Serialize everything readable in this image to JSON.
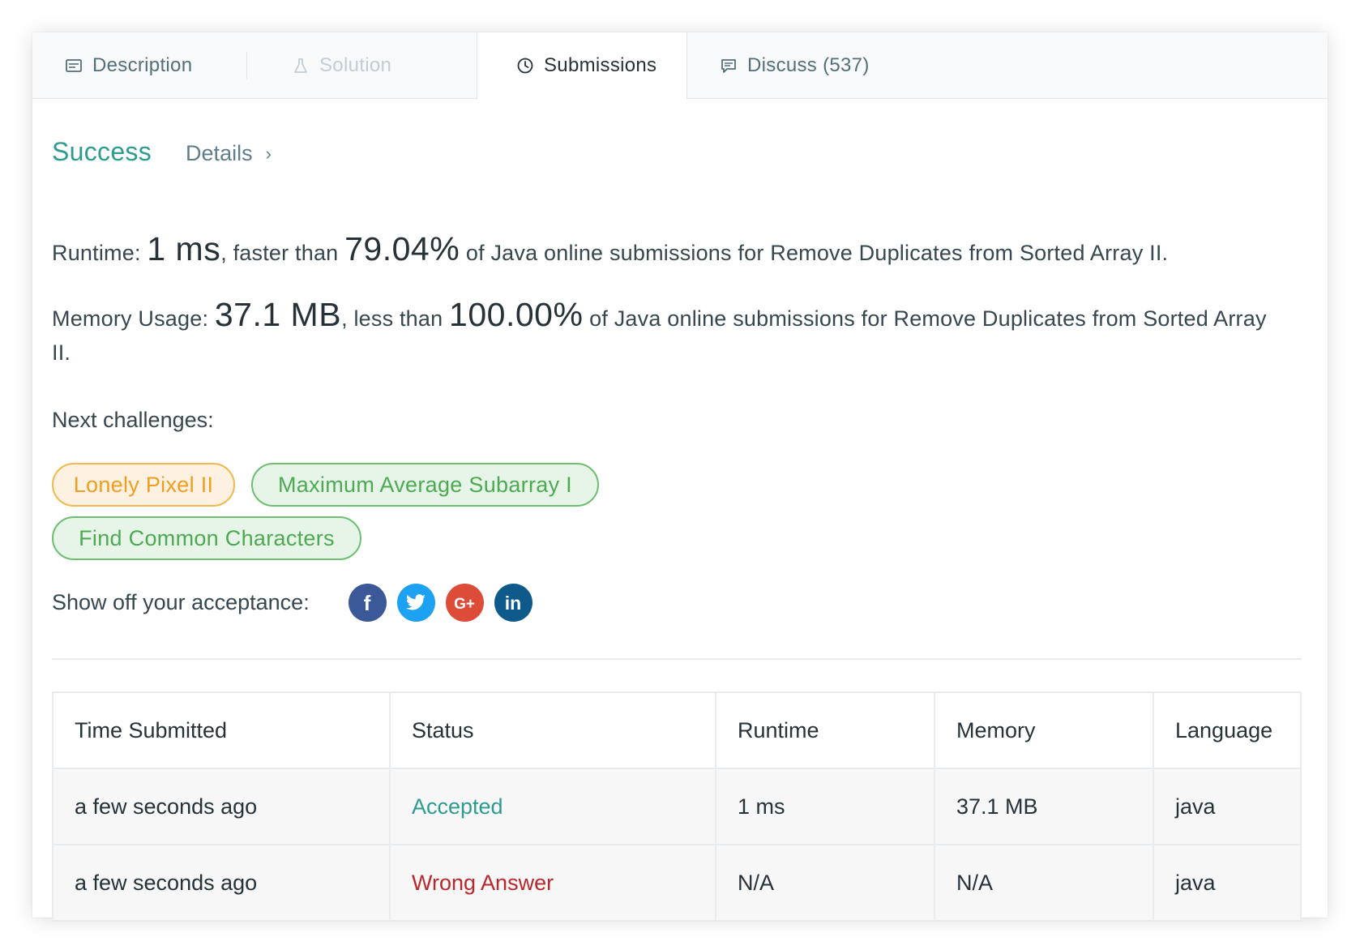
{
  "tabs": [
    {
      "label": "Description",
      "icon": "description-icon"
    },
    {
      "label": "Solution",
      "icon": "flask-icon"
    },
    {
      "label": "Submissions",
      "icon": "clock-icon"
    },
    {
      "label": "Discuss (537)",
      "icon": "comment-icon"
    }
  ],
  "result": {
    "status": "Success",
    "details_label": "Details",
    "details_chevron": "›"
  },
  "runtime": {
    "label": "Runtime:",
    "value": "1 ms",
    "comparison": ", faster than",
    "percent": "79.04%",
    "suffix": "of Java online submissions for Remove Duplicates from Sorted Array II."
  },
  "memory": {
    "label": "Memory Usage:",
    "value": "37.1 MB",
    "comparison": ", less than",
    "percent": "100.00%",
    "suffix": "of Java online submissions for Remove Duplicates from Sorted Array II."
  },
  "next_challenges": {
    "label": "Next challenges:",
    "items": [
      {
        "title": "Lonely Pixel II",
        "difficulty": "medium"
      },
      {
        "title": "Maximum Average Subarray I",
        "difficulty": "easy"
      },
      {
        "title": "Find Common Characters",
        "difficulty": "easy"
      }
    ]
  },
  "share": {
    "label": "Show off your acceptance:",
    "networks": [
      {
        "name": "facebook-icon",
        "color": "#3b5998",
        "glyph": "f"
      },
      {
        "name": "twitter-icon",
        "color": "#1da1f2",
        "glyph": ""
      },
      {
        "name": "google-plus-icon",
        "color": "#dd4b39",
        "glyph": "G+"
      },
      {
        "name": "linkedin-icon",
        "color": "#0e5a8a",
        "glyph": "in"
      }
    ]
  },
  "submissions": {
    "headers": [
      "Time Submitted",
      "Status",
      "Runtime",
      "Memory",
      "Language"
    ],
    "rows": [
      {
        "time": "a few seconds ago",
        "status": "Accepted",
        "runtime": "1 ms",
        "memory": "37.1 MB",
        "language": "java"
      },
      {
        "time": "a few seconds ago",
        "status": "Wrong Answer",
        "runtime": "N/A",
        "memory": "N/A",
        "language": "java"
      }
    ]
  },
  "colors": {
    "success": "#2e9b8f",
    "wrong_answer": "#b8282d",
    "medium_chip": "#ef9e20",
    "easy_chip": "#4ea953"
  }
}
